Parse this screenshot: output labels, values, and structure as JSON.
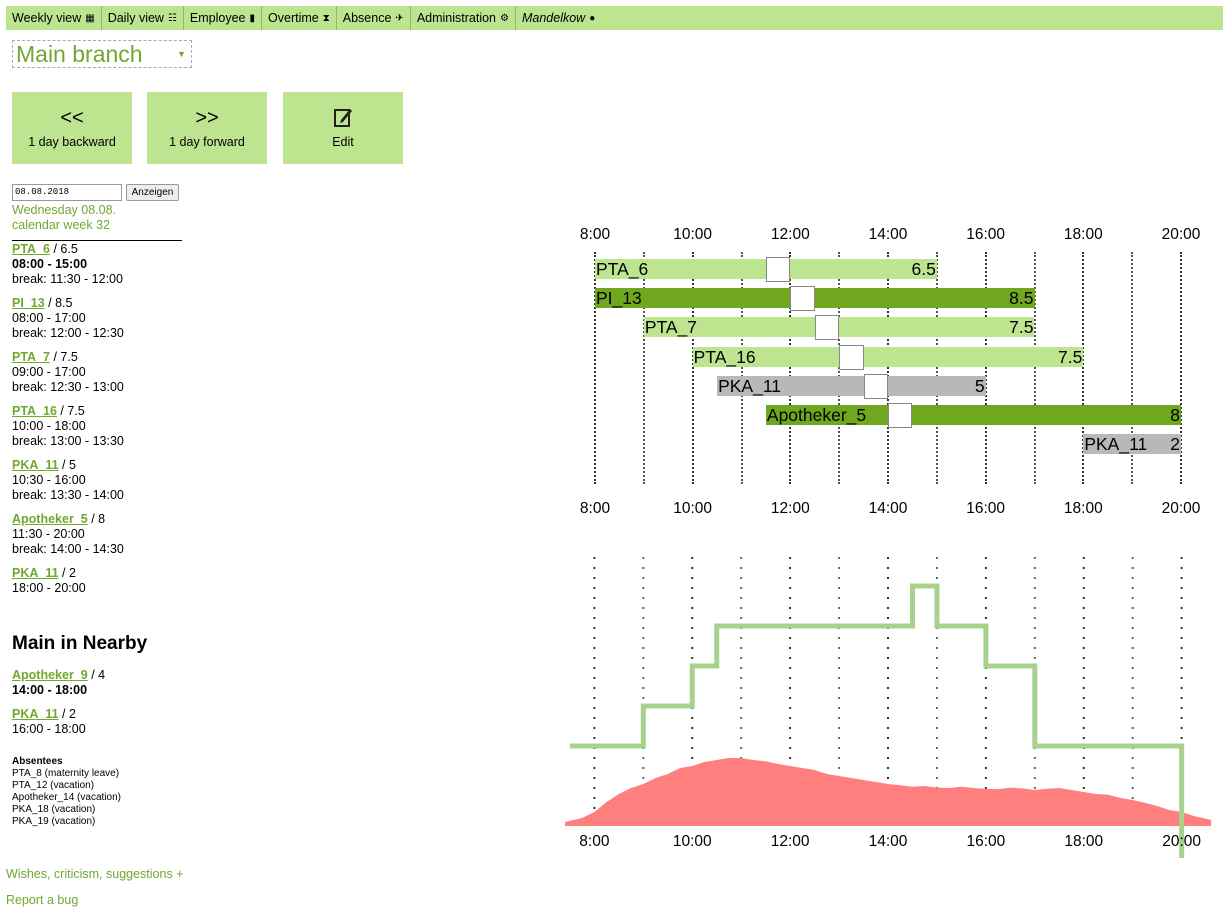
{
  "nav": {
    "weekly": "Weekly view",
    "daily": "Daily view",
    "employee": "Employee",
    "overtime": "Overtime",
    "absence": "Absence",
    "administration": "Administration",
    "user": "Mandelkow"
  },
  "branch": {
    "selected": "Main branch"
  },
  "buttons": {
    "backward": {
      "glyph": "<<",
      "label": "1 day backward"
    },
    "forward": {
      "glyph": ">>",
      "label": "1 day forward"
    },
    "edit": {
      "label": "Edit"
    }
  },
  "date": {
    "value": "08.08.2018",
    "show_label": "Anzeigen",
    "weekday": "Wednesday 08.08.",
    "week": "calendar week 32"
  },
  "roster": [
    {
      "name": "PTA_6",
      "hours": "6.5",
      "time": "08:00 - 15:00",
      "brk": "break: 11:30 - 12:00"
    },
    {
      "name": "PI_13",
      "hours": "8.5",
      "time": "08:00 - 17:00",
      "brk": "break: 12:00 - 12:30"
    },
    {
      "name": "PTA_7",
      "hours": "7.5",
      "time": "09:00 - 17:00",
      "brk": "break: 12:30 - 13:00"
    },
    {
      "name": "PTA_16",
      "hours": "7.5",
      "time": "10:00 - 18:00",
      "brk": "break: 13:00 - 13:30"
    },
    {
      "name": "PKA_11",
      "hours": "5",
      "time": "10:30 - 16:00",
      "brk": "break: 13:30 - 14:00"
    },
    {
      "name": "Apotheker_5",
      "hours": "8",
      "time": "11:30 - 20:00",
      "brk": "break: 14:00 - 14:30"
    },
    {
      "name": "PKA_11",
      "hours": "2",
      "time": "18:00 - 20:00",
      "brk": ""
    }
  ],
  "nearby": {
    "title": "Main in Nearby",
    "entries": [
      {
        "name": "Apotheker_9",
        "hours": "4",
        "time": "14:00 - 18:00"
      },
      {
        "name": "PKA_11",
        "hours": "2",
        "time": "16:00 - 18:00"
      }
    ]
  },
  "absentees": {
    "title": "Absentees",
    "items": [
      "PTA_8 (maternity leave)",
      "PTA_12 (vacation)",
      "Apotheker_14 (vacation)",
      "PKA_18 (vacation)",
      "PKA_19 (vacation)"
    ]
  },
  "footer": {
    "feedback": "Wishes, criticism, suggestions +",
    "bug": "Report a bug"
  },
  "colors": {
    "light_green": "#bde58f",
    "dark_green": "#6fa81f",
    "grey": "#b8b8b8",
    "staff_line": "#a9d18e",
    "demand_fill": "#ff7f7f",
    "accent_text": "#70a830"
  },
  "chart_data": [
    {
      "type": "gantt",
      "x_ticks": [
        "8:00",
        "10:00",
        "12:00",
        "14:00",
        "16:00",
        "18:00",
        "20:00"
      ],
      "xlim": [
        8,
        20
      ],
      "rows": [
        {
          "label": "PTA_6",
          "value": "6.5",
          "start": 8,
          "end": 15,
          "break_start": 11.5,
          "break_end": 12,
          "color": "light"
        },
        {
          "label": "PI_13",
          "value": "8.5",
          "start": 8,
          "end": 17,
          "break_start": 12,
          "break_end": 12.5,
          "color": "dark"
        },
        {
          "label": "PTA_7",
          "value": "7.5",
          "start": 9,
          "end": 17,
          "break_start": 12.5,
          "break_end": 13,
          "color": "light"
        },
        {
          "label": "PTA_16",
          "value": "7.5",
          "start": 10,
          "end": 18,
          "break_start": 13,
          "break_end": 13.5,
          "color": "light"
        },
        {
          "label": "PKA_11",
          "value": "5",
          "start": 10.5,
          "end": 16,
          "break_start": 13.5,
          "break_end": 14,
          "color": "grey"
        },
        {
          "label": "Apotheker_5",
          "value": "8",
          "start": 11.5,
          "end": 20,
          "break_start": 14,
          "break_end": 14.5,
          "color": "dark"
        },
        {
          "label": "PKA_11",
          "value": "2",
          "start": 18,
          "end": 20,
          "color": "grey"
        }
      ]
    },
    {
      "type": "line",
      "x_ticks": [
        "8:00",
        "10:00",
        "12:00",
        "14:00",
        "16:00",
        "18:00",
        "20:00"
      ],
      "xlim": [
        7.4,
        20.6
      ],
      "ylim": [
        0,
        7
      ],
      "series": [
        {
          "kind": "step",
          "color": "#a9d18e",
          "x": [
            8,
            9,
            10,
            10.5,
            14.5,
            15,
            16,
            17,
            20,
            20
          ],
          "y": [
            2,
            3,
            4,
            5,
            6,
            5,
            4,
            2,
            2,
            -0.8
          ]
        },
        {
          "kind": "area",
          "color": "#ff7f7f",
          "x": [
            7.4,
            7.75,
            8,
            8.25,
            8.5,
            8.75,
            9,
            9.25,
            9.5,
            9.75,
            10,
            10.25,
            10.5,
            10.75,
            11,
            11.25,
            11.5,
            11.75,
            12,
            12.25,
            12.5,
            12.75,
            13,
            13.25,
            13.5,
            13.75,
            14,
            14.25,
            14.5,
            14.75,
            15,
            15.25,
            15.5,
            15.75,
            16,
            16.25,
            16.5,
            16.75,
            17,
            17.25,
            17.5,
            17.75,
            18,
            18.25,
            18.5,
            18.75,
            19,
            19.25,
            19.5,
            19.75,
            20,
            20.25,
            20.6
          ],
          "y": [
            0.1,
            0.2,
            0.35,
            0.6,
            0.8,
            0.95,
            1.05,
            1.2,
            1.3,
            1.45,
            1.5,
            1.6,
            1.65,
            1.7,
            1.7,
            1.65,
            1.62,
            1.55,
            1.5,
            1.45,
            1.4,
            1.3,
            1.25,
            1.2,
            1.15,
            1.1,
            1.05,
            1.02,
            0.98,
            1.0,
            0.96,
            0.95,
            0.98,
            0.95,
            0.93,
            0.92,
            0.96,
            0.94,
            0.9,
            0.93,
            0.95,
            0.9,
            0.85,
            0.8,
            0.78,
            0.7,
            0.65,
            0.58,
            0.5,
            0.4,
            0.35,
            0.25,
            0.15
          ]
        }
      ]
    }
  ]
}
